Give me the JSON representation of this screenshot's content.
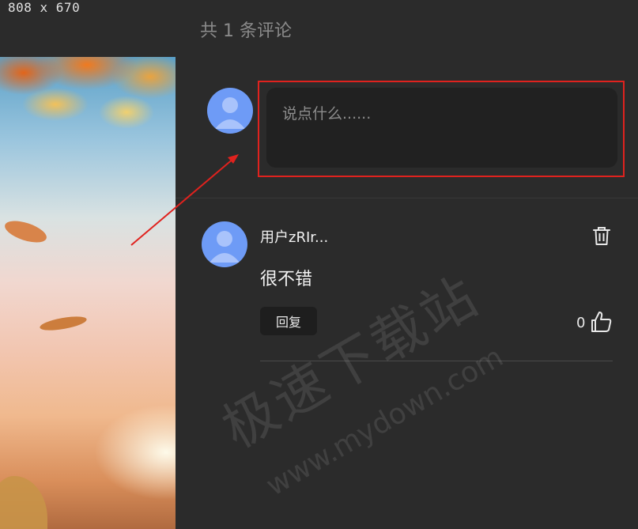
{
  "overlay": {
    "size_label": "808 x 670"
  },
  "header": {
    "comment_count": "共 1 条评论"
  },
  "composer": {
    "placeholder": "说点什么......"
  },
  "comments": [
    {
      "username": "用户zRIr...",
      "text": "很不错",
      "reply_label": "回复",
      "likes": "0"
    }
  ],
  "watermark": {
    "primary": "极速下载站",
    "secondary": "www.mydown.com"
  },
  "colors": {
    "background": "#2b2b2b",
    "input_bg": "#212121",
    "avatar": "#6e9bf6",
    "highlight": "#e0221e"
  },
  "icons": {
    "avatar": "user-avatar-icon",
    "trash": "trash-icon",
    "like": "thumbs-up-icon"
  }
}
